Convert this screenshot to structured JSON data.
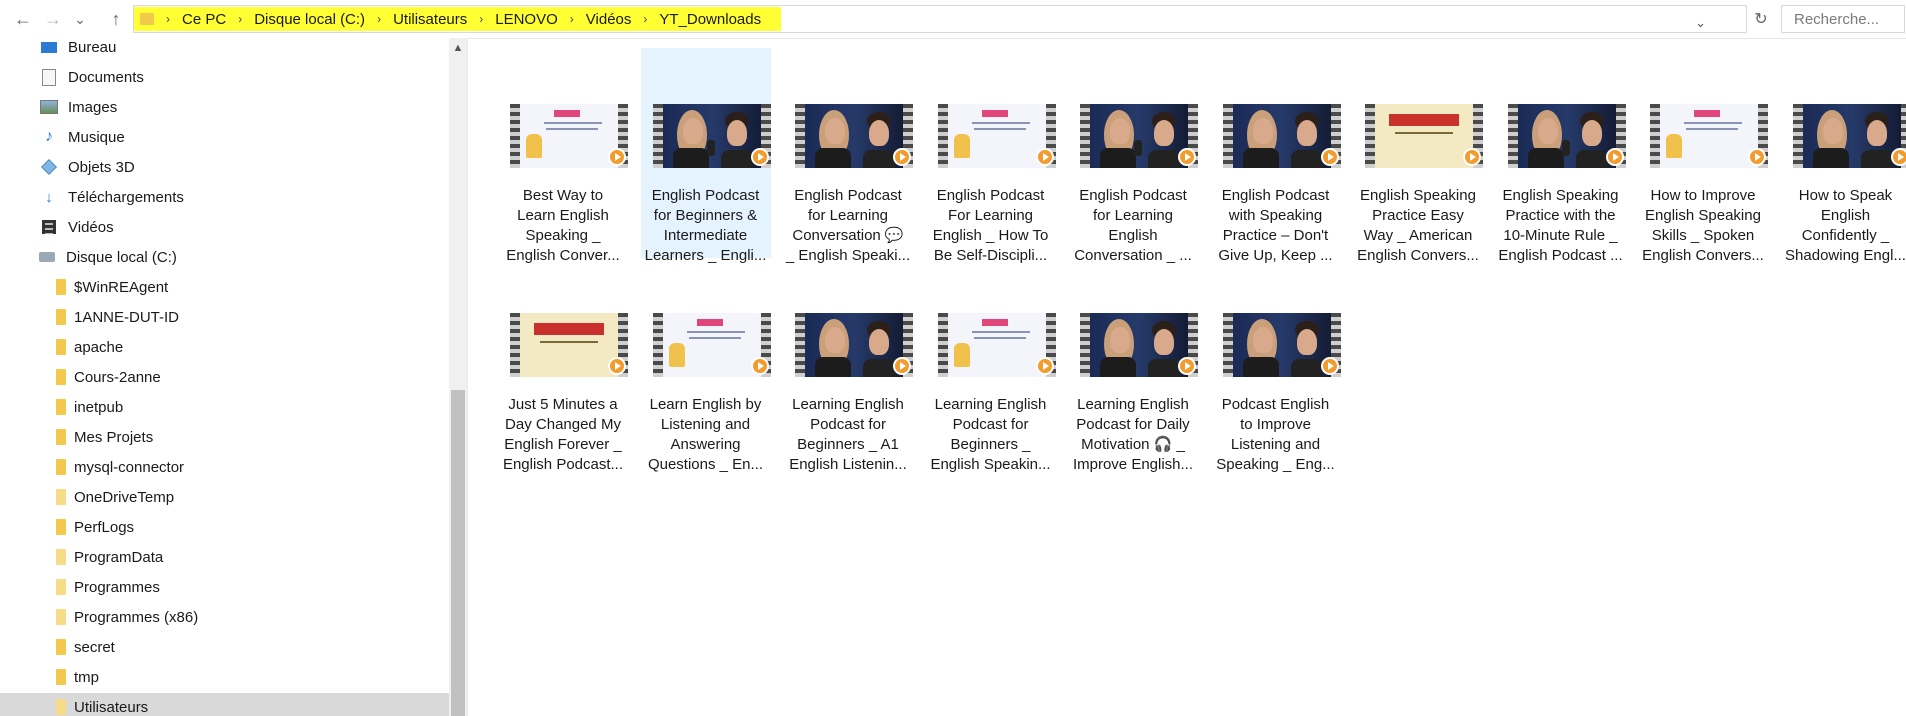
{
  "toolbar": {
    "back_icon": "back-arrow-icon",
    "forward_icon": "forward-arrow-icon",
    "recent_icon": "chevron-down-icon",
    "up_icon": "up-arrow-icon",
    "back_glyph": "←",
    "forward_glyph": "→",
    "recent_glyph": "⌄",
    "up_glyph": "↑",
    "refresh_glyph": "↻",
    "dropdown_glyph": "⌄"
  },
  "breadcrumb": [
    "Ce PC",
    "Disque local (C:)",
    "Utilisateurs",
    "LENOVO",
    "Vidéos",
    "YT_Downloads"
  ],
  "breadcrumb_separator": "›",
  "highlight_color": "#ffff33",
  "search": {
    "placeholder": "Recherche..."
  },
  "sidebar": {
    "items": [
      {
        "label": "Bureau",
        "icon": "desktop-icon"
      },
      {
        "label": "Documents",
        "icon": "documents-icon"
      },
      {
        "label": "Images",
        "icon": "images-icon"
      },
      {
        "label": "Musique",
        "icon": "music-icon"
      },
      {
        "label": "Objets 3D",
        "icon": "cube-icon"
      },
      {
        "label": "Téléchargements",
        "icon": "download-icon"
      },
      {
        "label": "Vidéos",
        "icon": "video-icon"
      },
      {
        "label": "Disque local (C:)",
        "icon": "drive-icon"
      },
      {
        "label": "$WinREAgent",
        "icon": "folder-icon"
      },
      {
        "label": "1ANNE-DUT-ID",
        "icon": "folder-icon"
      },
      {
        "label": "apache",
        "icon": "folder-icon"
      },
      {
        "label": "Cours-2anne",
        "icon": "folder-icon"
      },
      {
        "label": "inetpub",
        "icon": "folder-icon"
      },
      {
        "label": "Mes Projets",
        "icon": "folder-icon"
      },
      {
        "label": "mysql-connector",
        "icon": "folder-icon"
      },
      {
        "label": "OneDriveTemp",
        "icon": "folder-icon"
      },
      {
        "label": "PerfLogs",
        "icon": "folder-icon"
      },
      {
        "label": "ProgramData",
        "icon": "folder-icon"
      },
      {
        "label": "Programmes",
        "icon": "folder-icon"
      },
      {
        "label": "Programmes (x86)",
        "icon": "folder-icon"
      },
      {
        "label": "secret",
        "icon": "folder-icon"
      },
      {
        "label": "tmp",
        "icon": "folder-icon"
      },
      {
        "label": "Utilisateurs",
        "icon": "folder-icon"
      }
    ]
  },
  "files": [
    {
      "caption": "Best Way to\nLearn English\nSpeaking _\nEnglish Conver...",
      "thumb": "light"
    },
    {
      "caption": "English Podcast\nfor Beginners &\nIntermediate\nLearners _ Engli...",
      "thumb": "dark"
    },
    {
      "caption": "English Podcast\nfor Learning\nConversation 💬\n_ English Speaki...",
      "thumb": "dark"
    },
    {
      "caption": "English Podcast\nFor Learning\nEnglish _ How To\nBe Self-Discipli...",
      "thumb": "light"
    },
    {
      "caption": "English Podcast\nfor Learning\nEnglish\nConversation _ ...",
      "thumb": "dark"
    },
    {
      "caption": "English Podcast\nwith Speaking\nPractice – Don't\nGive Up, Keep ...",
      "thumb": "dark"
    },
    {
      "caption": "English Speaking\nPractice Easy\nWay _ American\nEnglish Convers...",
      "thumb": "cream"
    },
    {
      "caption": "English Speaking\nPractice with the\n10-Minute Rule _\nEnglish Podcast ...",
      "thumb": "dark"
    },
    {
      "caption": "How to Improve\nEnglish Speaking\nSkills _ Spoken\nEnglish Convers...",
      "thumb": "light"
    },
    {
      "caption": "How to Speak\nEnglish\nConfidently _\nShadowing Engl...",
      "thumb": "dark"
    },
    {
      "caption": "Just 5 Minutes a\nDay Changed My\nEnglish Forever _\nEnglish Podcast...",
      "thumb": "cream"
    },
    {
      "caption": "Learn English by\nListening and\nAnswering\nQuestions _ En...",
      "thumb": "light"
    },
    {
      "caption": "Learning English\nPodcast for\nBeginners _ A1\nEnglish Listenin...",
      "thumb": "dark"
    },
    {
      "caption": "Learning English\nPodcast for\nBeginners _\nEnglish Speakin...",
      "thumb": "light"
    },
    {
      "caption": "Learning English\nPodcast for Daily\nMotivation 🎧 _\nImprove English...",
      "thumb": "dark"
    },
    {
      "caption": "Podcast English\nto Improve\nListening and\nSpeaking _ Eng...",
      "thumb": "dark"
    }
  ],
  "thumb_text": {
    "cream_title": "English Podcast",
    "light_line": "we help you learn real"
  }
}
